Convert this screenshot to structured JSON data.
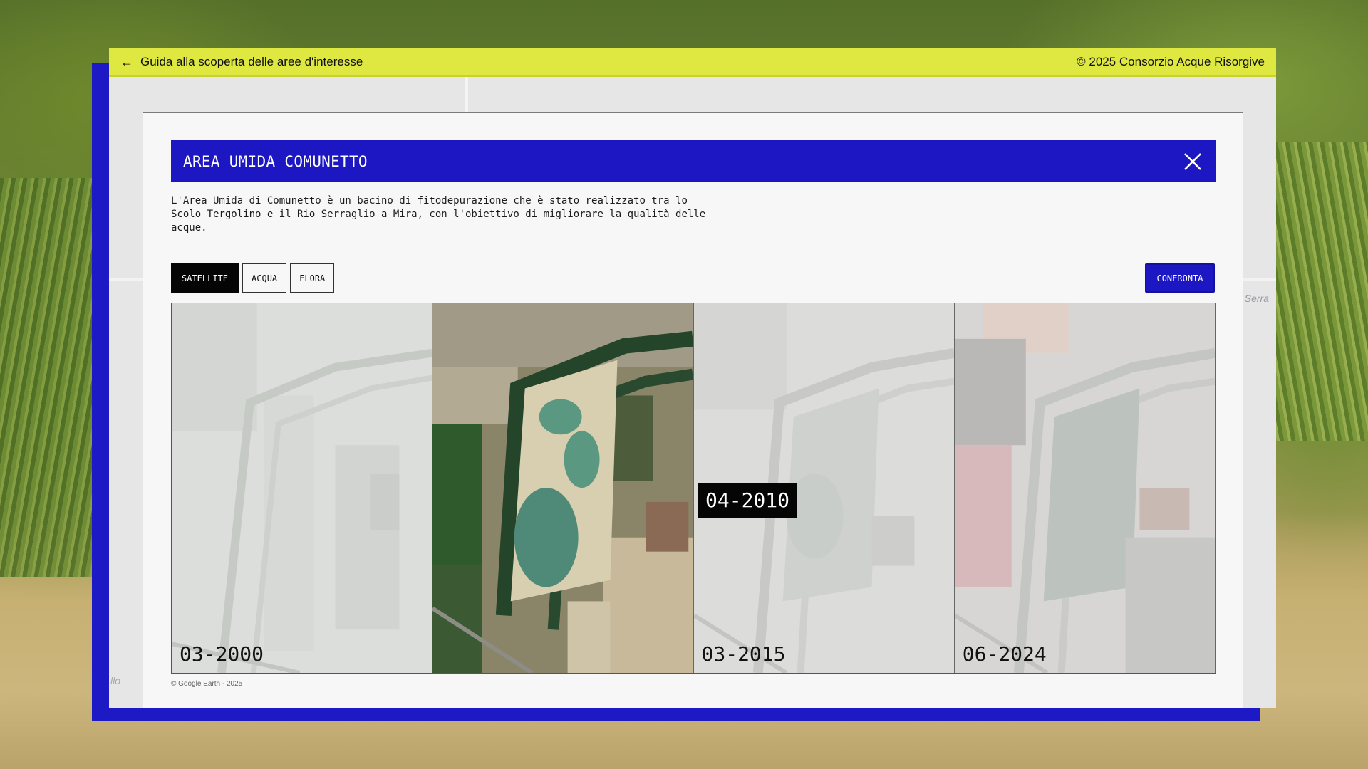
{
  "topbar": {
    "back_label": "Guida alla scoperta delle aree d'interesse",
    "copyright": "© 2025 Consorzio Acque Risorgive"
  },
  "panel": {
    "title": "AREA UMIDA COMUNETTO",
    "description": "L'Area Umida di Comunetto è un bacino di fitodepurazione che è stato realizzato tra lo Scolo Tergolino e il Rio Serraglio a Mira, con l'obiettivo di migliorare la qualità delle acque.",
    "tabs": [
      {
        "label": "SATELLITE",
        "active": true
      },
      {
        "label": "ACQUA",
        "active": false
      },
      {
        "label": "FLORA",
        "active": false
      }
    ],
    "compare_label": "CONFRONTA",
    "images": [
      {
        "date": "03-2000",
        "state": "faded"
      },
      {
        "date": "04-2010",
        "state": "highlighted"
      },
      {
        "date": "03-2015",
        "state": "faded"
      },
      {
        "date": "06-2024",
        "state": "faded"
      }
    ],
    "hover_date": "04-2010",
    "credit": "© Google Earth - 2025"
  },
  "map_labels": {
    "right": "o Serra",
    "left": "llo"
  },
  "colors": {
    "accent_blue": "#1d16c3",
    "topbar_yellow": "#dfe841",
    "tab_active": "#050505"
  },
  "icons": {
    "back": "arrow-left-icon",
    "close": "close-icon"
  }
}
